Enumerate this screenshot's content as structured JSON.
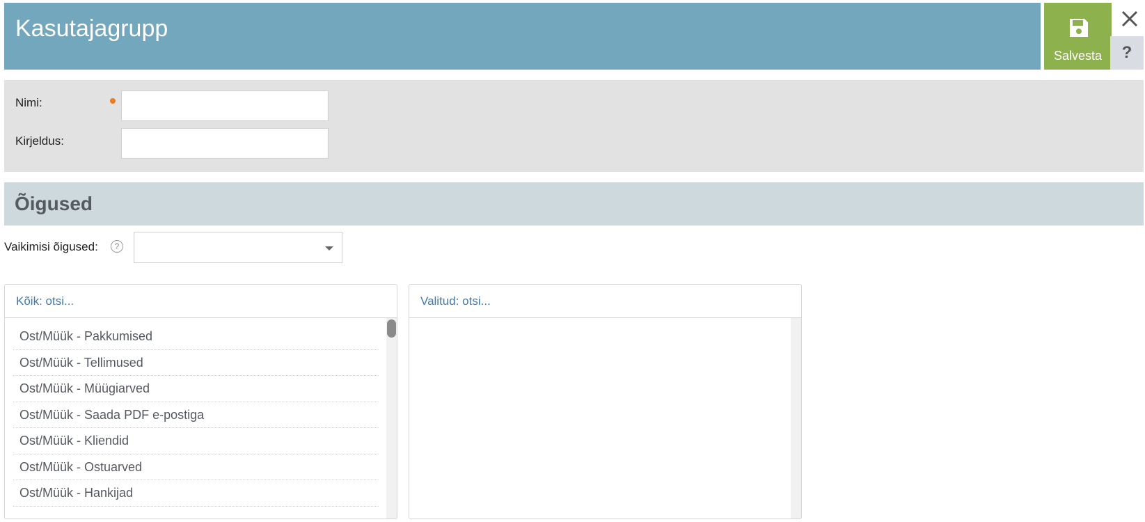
{
  "header": {
    "title": "Kasutajagrupp",
    "save_label": "Salvesta",
    "close_glyph": "✕",
    "help_glyph": "?"
  },
  "form": {
    "name_label": "Nimi:",
    "name_value": "",
    "description_label": "Kirjeldus:",
    "description_value": ""
  },
  "permissions": {
    "section_title": "Õigused",
    "default_label": "Vaikimisi õigused:",
    "default_help_glyph": "?",
    "default_selected": ""
  },
  "all_list": {
    "search_placeholder": "Kõik: otsi...",
    "items": [
      "Ost/Müük - Pakkumised",
      "Ost/Müük - Tellimused",
      "Ost/Müük - Müügiarved",
      "Ost/Müük - Saada PDF e-postiga",
      "Ost/Müük - Kliendid",
      "Ost/Müük - Ostuarved",
      "Ost/Müük - Hankijad"
    ]
  },
  "selected_list": {
    "search_placeholder": "Valitud: otsi...",
    "items": []
  },
  "colors": {
    "header_bg": "#72a7bd",
    "save_bg": "#8db14c",
    "section_bg": "#cdd9dc",
    "form_bg": "#e2e2e2",
    "required": "#f07a22",
    "link_blue": "#3d7ab0"
  },
  "icons": {
    "save": "floppy-disk-icon",
    "close": "close-icon",
    "help": "question-icon",
    "dropdown": "caret-down-icon"
  }
}
